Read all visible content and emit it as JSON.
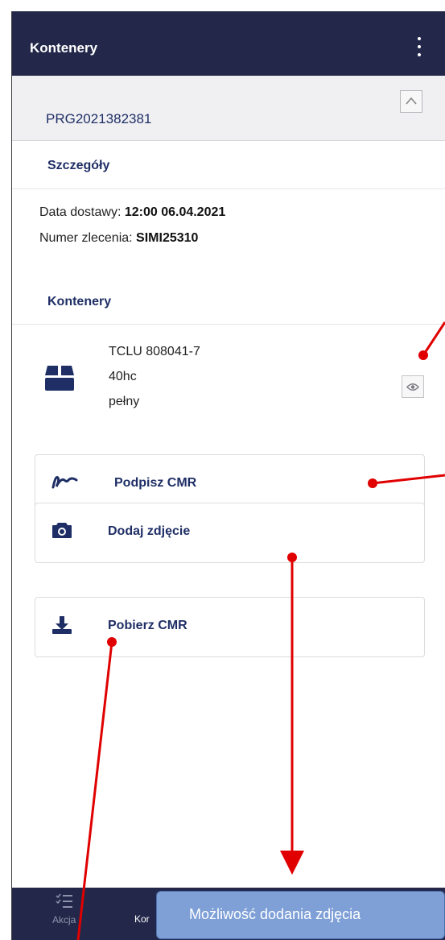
{
  "app": {
    "title": "Kontenery"
  },
  "order": {
    "number": "PRG2021382381"
  },
  "details": {
    "heading": "Szczegóły",
    "delivery_label": "Data dostawy: ",
    "delivery_value": "12:00 06.04.2021",
    "order_label": "Numer zlecenia: ",
    "order_value": "SIMI25310"
  },
  "containers": {
    "heading": "Kontenery",
    "items": [
      {
        "number": "TCLU 808041-7",
        "type": "40hc",
        "status": "pełny"
      }
    ]
  },
  "actions": {
    "sign_cmr": "Podpisz CMR",
    "add_photo": "Dodaj zdjęcie",
    "download_cmr": "Pobierz CMR"
  },
  "bottom_nav": {
    "actions_label": "Akcja",
    "containers_label": "Kor"
  },
  "annotation": {
    "callout_text": "Możliwość dodania zdjęcia",
    "marker_color": "#e00000"
  },
  "icons": [
    "kebab-menu-icon",
    "chevron-up-icon",
    "container-box-icon",
    "eye-icon",
    "signature-icon",
    "camera-icon",
    "download-icon",
    "checklist-icon"
  ]
}
